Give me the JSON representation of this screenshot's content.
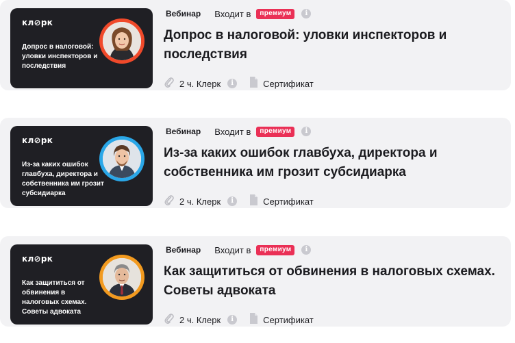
{
  "logo_text": "кл⊘рк",
  "courses": [
    {
      "thumb_text": "Допрос в налоговой: уловки инспекторов и последствия",
      "ring_color": "#f0492a",
      "type": "Вебинар",
      "includes_label": "Входит в",
      "premium_label": "премиум",
      "title": "Допрос в налоговой: уловки инспекторов и последствия",
      "duration": "2 ч. Клерк",
      "certificate": "Сертификат"
    },
    {
      "thumb_text": "Из-за каких ошибок главбуха, директора и собственника им грозит субсидиарка",
      "ring_color": "#2aa7e8",
      "type": "Вебинар",
      "includes_label": "Входит в",
      "premium_label": "премиум",
      "title": "Из-за каких ошибок главбуха, директора и собственника им грозит субсидиарка",
      "duration": "2 ч. Клерк",
      "certificate": "Сертификат"
    },
    {
      "thumb_text": "Как защититься от обвинения в налоговых схемах. Советы адвоката",
      "ring_color": "#f29a1f",
      "type": "Вебинар",
      "includes_label": "Входит в",
      "premium_label": "премиум",
      "title": "Как защититься от обвинения в налоговых схемах. Советы адвоката",
      "duration": "2 ч. Клерк",
      "certificate": "Сертификат"
    }
  ],
  "icons": {
    "info": "info-icon",
    "duration": "paperclip-icon",
    "certificate": "document-icon"
  }
}
